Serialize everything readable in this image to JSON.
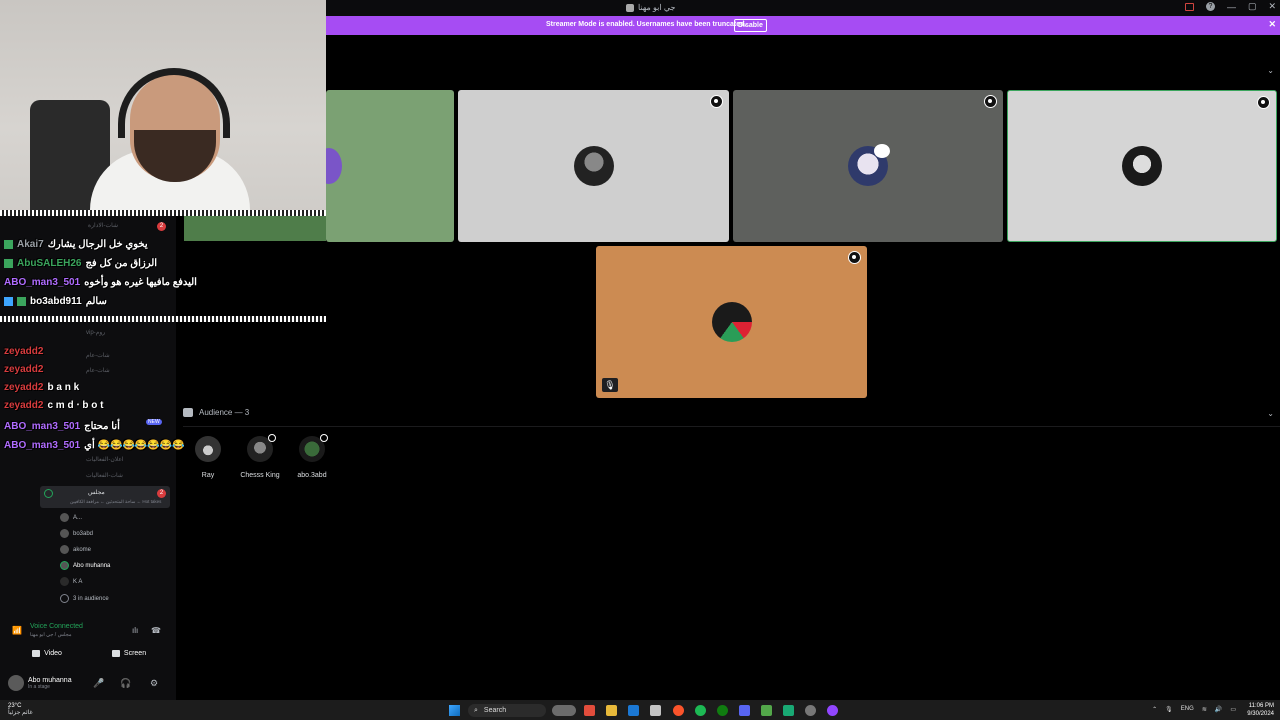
{
  "window": {
    "title": "جي ابو مهنا",
    "controls": [
      "—",
      "▢",
      "✕"
    ]
  },
  "banner": {
    "message": "Streamer Mode is enabled. Usernames have been truncated.",
    "disable_label": "Disable",
    "close": "✕"
  },
  "colors": {
    "banner": "#a64cf3",
    "tile_green": "#7ba173",
    "tile_light": "#c9c9c9",
    "tile_dark": "#5f615e",
    "tile_orange": "#cc8b52",
    "voice_green": "#23a55a"
  },
  "stage": {
    "tiles": [
      {
        "name": "tile-partial",
        "bg": "#7ba173"
      },
      {
        "name": "tile-2",
        "bg": "#cfcfcf"
      },
      {
        "name": "tile-3",
        "bg": "#5e605d"
      },
      {
        "name": "tile-4",
        "bg": "#d5d5d5"
      },
      {
        "name": "tile-5",
        "bg": "#cc8b52"
      }
    ]
  },
  "audience": {
    "header": "Audience — 3",
    "members": [
      {
        "name": "Ray"
      },
      {
        "name": "Chesss King"
      },
      {
        "name": "abo.3abd"
      }
    ]
  },
  "chat": [
    {
      "user": "Akai7",
      "color": "#9aa0a6",
      "message": "يخوي خل الرجال يشارك"
    },
    {
      "user": "AbuSALEH26",
      "color": "#3ba55d",
      "message": "الرزاق من كل فج"
    },
    {
      "user": "ABO_man3_501",
      "color": "#b06cff",
      "message": "اليدفع مافيها غيره هو وأخوه"
    },
    {
      "user": "bo3abd911",
      "color": "#ffffff",
      "message": "سالم"
    },
    {
      "user": "zeyadd2",
      "color": "#d83c3e",
      "message": ""
    },
    {
      "user": "zeyadd2",
      "color": "#d83c3e",
      "message": ""
    },
    {
      "user": "zeyadd2",
      "color": "#d83c3e",
      "message": "b a n k"
    },
    {
      "user": "zeyadd2",
      "color": "#d83c3e",
      "message": "c m d ‧ b o t"
    },
    {
      "user": "ABO_man3_501",
      "color": "#b06cff",
      "message": "أنا محتاج"
    },
    {
      "user": "ABO_man3_501",
      "color": "#b06cff",
      "message": "أي 😂😂😂😂😂😂😂"
    }
  ],
  "sidebar": {
    "channels": [
      "شات-الادارة",
      "vip-روم",
      "شات-عام",
      "شات-عام",
      "اعلان-الفعاليات",
      "شات-الفعاليات"
    ],
    "active_stage": "مجلس",
    "active_stage_topic": "ساحة المتحدثين ← مرافعة الكافيين ← Hot takes",
    "voice_users": [
      "A...",
      "bo3abd",
      "akome",
      "Abo muhanna",
      "K A"
    ],
    "audience_count": "3 in audience",
    "badge_count": "2",
    "new_badge": "NEW"
  },
  "voice": {
    "status": "Voice Connected",
    "channel": "مجلس / جي ابو مهنا",
    "video_label": "Video",
    "screen_label": "Screen",
    "user_name": "Abo muhanna",
    "user_status": "In a stage"
  },
  "taskbar": {
    "temperature": "23°C",
    "weather": "غائم جزئياً",
    "search": "Search",
    "lang": "ENG",
    "time": "11:06 PM",
    "date": "9/30/2024"
  }
}
